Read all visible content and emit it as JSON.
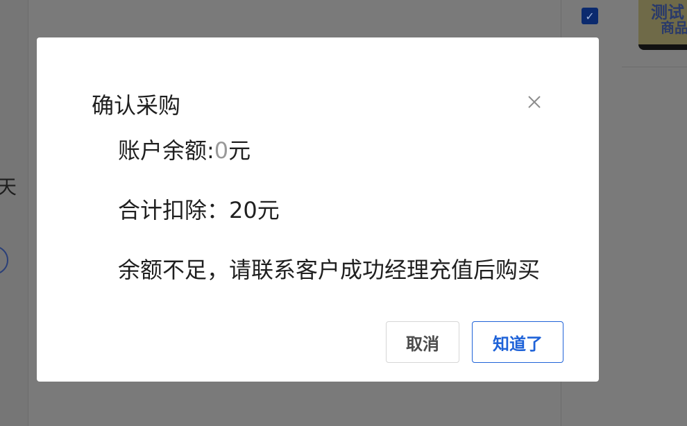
{
  "background": {
    "thumb_text_line1": "测试",
    "thumb_text_line2": "商品",
    "partial_char": "天"
  },
  "dialog": {
    "title": "确认采购",
    "balance_label": "账户余额:",
    "balance_value": "0",
    "balance_unit": "元",
    "deduct_label": "合计扣除：",
    "deduct_value": "20元",
    "message": "余额不足，请联系客户成功经理充值后购买",
    "cancel_label": "取消",
    "ok_label": "知道了"
  },
  "colors": {
    "accent": "#1e62d8",
    "overlay": "#7a7a7a",
    "muted_value": "#999999"
  }
}
